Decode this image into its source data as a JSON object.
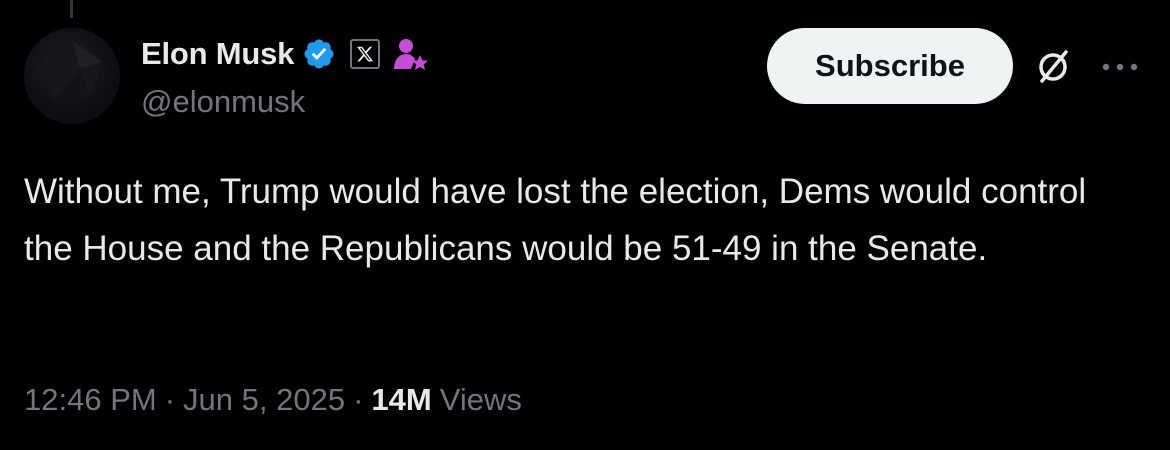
{
  "tweet": {
    "author": {
      "display_name": "Elon Musk",
      "handle": "@elonmusk",
      "verified_icon": "verified-badge-icon",
      "affiliate_icon": "x-logo-icon",
      "role_icon": "person-star-icon"
    },
    "subscribe_label": "Subscribe",
    "actions": {
      "grok_icon": "grok-icon",
      "more_icon": "more-dots-icon"
    },
    "text": "Without me, Trump would have lost the election, Dems would control the House and the Republicans would be 51-49 in the Senate.",
    "meta": {
      "time": "12:46 PM",
      "separator": "·",
      "date": "Jun 5, 2025",
      "views_count": "14M",
      "views_label": "Views"
    }
  },
  "colors": {
    "background": "#000000",
    "primary_text": "#e7e9ea",
    "secondary_text": "#71767b",
    "verified_blue": "#1d9bf0",
    "role_magenta": "#c74bd9",
    "subscribe_bg": "#eff3f4"
  }
}
